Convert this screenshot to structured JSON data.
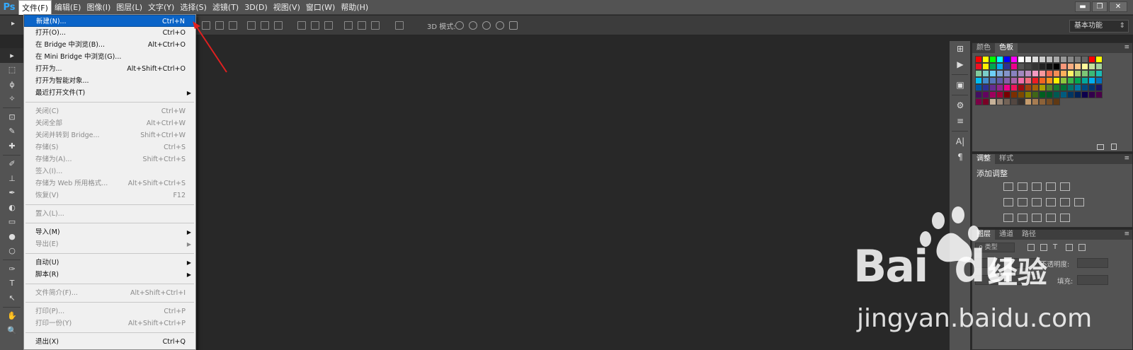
{
  "app": {
    "logo": "Ps"
  },
  "menubar": {
    "items": [
      "文件(F)",
      "编辑(E)",
      "图像(I)",
      "图层(L)",
      "文字(Y)",
      "选择(S)",
      "滤镜(T)",
      "3D(D)",
      "视图(V)",
      "窗口(W)",
      "帮助(H)"
    ],
    "active_index": 0
  },
  "window_controls": {
    "minimize": "▬",
    "restore": "❐",
    "close": "✕"
  },
  "options_bar": {
    "label_3d": "3D 模式:",
    "workspace": "基本功能"
  },
  "file_menu": {
    "items": [
      {
        "label": "新建(N)...",
        "shortcut": "Ctrl+N",
        "state": "highlighted"
      },
      {
        "label": "打开(O)...",
        "shortcut": "Ctrl+O",
        "state": "enabled"
      },
      {
        "label": "在 Bridge 中浏览(B)...",
        "shortcut": "Alt+Ctrl+O",
        "state": "enabled"
      },
      {
        "label": "在 Mini Bridge 中浏览(G)...",
        "shortcut": "",
        "state": "enabled"
      },
      {
        "label": "打开为...",
        "shortcut": "Alt+Shift+Ctrl+O",
        "state": "enabled"
      },
      {
        "label": "打开为智能对象...",
        "shortcut": "",
        "state": "enabled"
      },
      {
        "label": "最近打开文件(T)",
        "shortcut": "",
        "state": "enabled",
        "submenu": true
      },
      {
        "sep": true
      },
      {
        "label": "关闭(C)",
        "shortcut": "Ctrl+W",
        "state": "disabled"
      },
      {
        "label": "关闭全部",
        "shortcut": "Alt+Ctrl+W",
        "state": "disabled"
      },
      {
        "label": "关闭并转到 Bridge...",
        "shortcut": "Shift+Ctrl+W",
        "state": "disabled"
      },
      {
        "label": "存储(S)",
        "shortcut": "Ctrl+S",
        "state": "disabled"
      },
      {
        "label": "存储为(A)...",
        "shortcut": "Shift+Ctrl+S",
        "state": "disabled"
      },
      {
        "label": "签入(I)...",
        "shortcut": "",
        "state": "disabled"
      },
      {
        "label": "存储为 Web 所用格式...",
        "shortcut": "Alt+Shift+Ctrl+S",
        "state": "disabled"
      },
      {
        "label": "恢复(V)",
        "shortcut": "F12",
        "state": "disabled"
      },
      {
        "sep": true
      },
      {
        "label": "置入(L)...",
        "shortcut": "",
        "state": "disabled"
      },
      {
        "sep": true
      },
      {
        "label": "导入(M)",
        "shortcut": "",
        "state": "enabled",
        "submenu": true
      },
      {
        "label": "导出(E)",
        "shortcut": "",
        "state": "disabled",
        "submenu": true
      },
      {
        "sep": true
      },
      {
        "label": "自动(U)",
        "shortcut": "",
        "state": "enabled",
        "submenu": true
      },
      {
        "label": "脚本(R)",
        "shortcut": "",
        "state": "enabled",
        "submenu": true
      },
      {
        "sep": true
      },
      {
        "label": "文件简介(F)...",
        "shortcut": "Alt+Shift+Ctrl+I",
        "state": "disabled"
      },
      {
        "sep": true
      },
      {
        "label": "打印(P)...",
        "shortcut": "Ctrl+P",
        "state": "disabled"
      },
      {
        "label": "打印一份(Y)",
        "shortcut": "Alt+Shift+Ctrl+P",
        "state": "disabled"
      },
      {
        "sep": true
      },
      {
        "label": "退出(X)",
        "shortcut": "Ctrl+Q",
        "state": "enabled"
      }
    ]
  },
  "toolbar": {
    "tools": [
      "▸",
      "⬚",
      "ϕ",
      "✧",
      "⊡",
      "✎",
      "✚",
      "✐",
      "⊥",
      "✒",
      "◐",
      "▭",
      "●",
      "○",
      "✑",
      "T",
      "↖",
      "✋",
      "🔍"
    ]
  },
  "dock_icons": [
    "⊞",
    "▶",
    "▣",
    "⚙",
    "≡",
    "A|",
    "¶"
  ],
  "panels": {
    "color": {
      "tabs": [
        "颜色",
        "色板"
      ],
      "active": 1
    },
    "adjust": {
      "tabs": [
        "调整",
        "样式"
      ],
      "active": 0,
      "title": "添加调整"
    },
    "layers": {
      "tabs": [
        "图层",
        "通道",
        "路径"
      ],
      "active": 0,
      "kind": "ρ 类型",
      "opacity_label": "不透明度:",
      "fill_label": "填充:"
    }
  },
  "swatch_colors": [
    "#ff0000",
    "#ffff00",
    "#00ff00",
    "#00ffff",
    "#0000ff",
    "#ff00ff",
    "#ffffff",
    "#eeeeee",
    "#dddddd",
    "#cccccc",
    "#bbbbbb",
    "#aaaaaa",
    "#999999",
    "#888888",
    "#777777",
    "#666666",
    "#ff0000",
    "#ffff00",
    "#ee1122",
    "#ffee00",
    "#00a651",
    "#00aeef",
    "#2e3192",
    "#ec008c",
    "#555555",
    "#444444",
    "#333333",
    "#222222",
    "#111111",
    "#000000",
    "#f7977a",
    "#f9ad81",
    "#fdc68a",
    "#fff79a",
    "#c4df9b",
    "#a3d39c",
    "#82ca9d",
    "#7bcdc8",
    "#6ecff6",
    "#7ea7d8",
    "#8493ca",
    "#8882be",
    "#a187be",
    "#bc8dbf",
    "#f49ac2",
    "#f6989d",
    "#f26c4f",
    "#f68e55",
    "#fbaf5c",
    "#fff467",
    "#acd372",
    "#7cc576",
    "#3bb878",
    "#1abbb4",
    "#00bff3",
    "#438ccb",
    "#5574b9",
    "#605ca8",
    "#855fa8",
    "#a763a8",
    "#f06ea9",
    "#f26d7d",
    "#ed1c24",
    "#f26522",
    "#f7941d",
    "#fff200",
    "#8dc73f",
    "#39b54a",
    "#00a651",
    "#00a99d",
    "#00aeef",
    "#0072bc",
    "#0054a6",
    "#2e3192",
    "#662d91",
    "#92278f",
    "#ec008c",
    "#ed145b",
    "#9e0b0f",
    "#a0410d",
    "#a36209",
    "#aba000",
    "#598527",
    "#197b30",
    "#007236",
    "#00746b",
    "#0076a3",
    "#004b80",
    "#003471",
    "#1b1464",
    "#440e62",
    "#630460",
    "#9e005d",
    "#9e0039",
    "#790000",
    "#7b2e00",
    "#7d4900",
    "#827b00",
    "#406618",
    "#005e20",
    "#005826",
    "#005952",
    "#005b7f",
    "#003663",
    "#002157",
    "#0d004c",
    "#32004b",
    "#4b0049",
    "#7b0046",
    "#7a0026",
    "#c7b299",
    "#998675",
    "#736357",
    "#534741",
    "#37302d",
    "#c69c6d",
    "#a67c52",
    "#8c6239",
    "#754c24",
    "#603913"
  ],
  "watermark": {
    "brand_a": "Bai",
    "brand_b": "du",
    "brand_cn": "经验",
    "url": "jingyan.baidu.com"
  }
}
